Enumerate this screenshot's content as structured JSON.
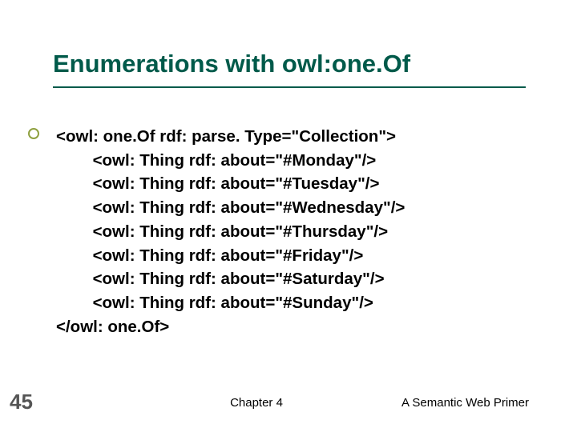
{
  "slide": {
    "title": "Enumerations with owl:one.Of",
    "code": "<owl: one.Of rdf: parse. Type=\"Collection\">\n        <owl: Thing rdf: about=\"#Monday\"/>\n        <owl: Thing rdf: about=\"#Tuesday\"/>\n        <owl: Thing rdf: about=\"#Wednesday\"/>\n        <owl: Thing rdf: about=\"#Thursday\"/>\n        <owl: Thing rdf: about=\"#Friday\"/>\n        <owl: Thing rdf: about=\"#Saturday\"/>\n        <owl: Thing rdf: about=\"#Sunday\"/>\n</owl: one.Of>",
    "page_number": "45",
    "footer_center": "Chapter 4",
    "footer_right": "A Semantic Web Primer"
  }
}
